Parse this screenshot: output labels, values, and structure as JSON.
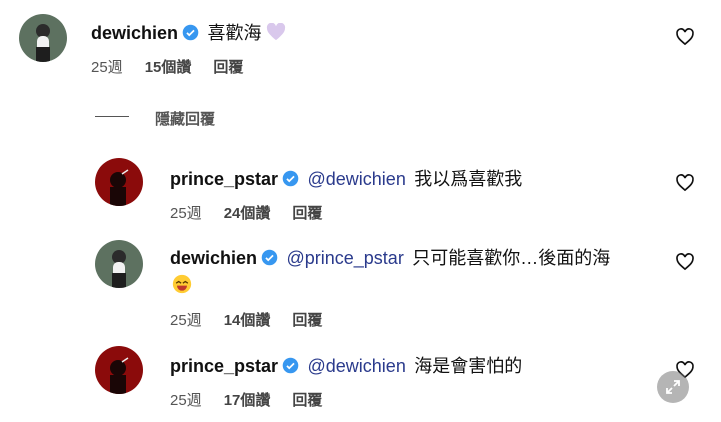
{
  "comments": [
    {
      "username": "dewichien",
      "mention": "",
      "text": "喜歡海",
      "time": "25週",
      "likes": "15個讚",
      "reply": "回覆"
    },
    {
      "username": "prince_pstar",
      "mention": "@dewichien",
      "text": "我以爲喜歡我",
      "time": "25週",
      "likes": "24個讚",
      "reply": "回覆"
    },
    {
      "username": "dewichien",
      "mention": "@prince_pstar",
      "text": "只可能喜歡你…後面的海",
      "time": "25週",
      "likes": "14個讚",
      "reply": "回覆"
    },
    {
      "username": "prince_pstar",
      "mention": "@dewichien",
      "text": "海是會害怕的",
      "time": "25週",
      "likes": "17個讚",
      "reply": "回覆"
    }
  ],
  "hide_replies": "隱藏回覆",
  "colors": {
    "verified": "#3797f0",
    "mention": "#2a3a8c",
    "meta": "#555555",
    "prince_avatar_bg": "#8b0b0b"
  },
  "icons": {
    "heart": "heart-outline-icon",
    "verified": "verified-badge-icon",
    "purple_heart": "purple-heart-emoji",
    "grin": "grinning-face-emoji",
    "expand": "expand-arrows-icon"
  }
}
